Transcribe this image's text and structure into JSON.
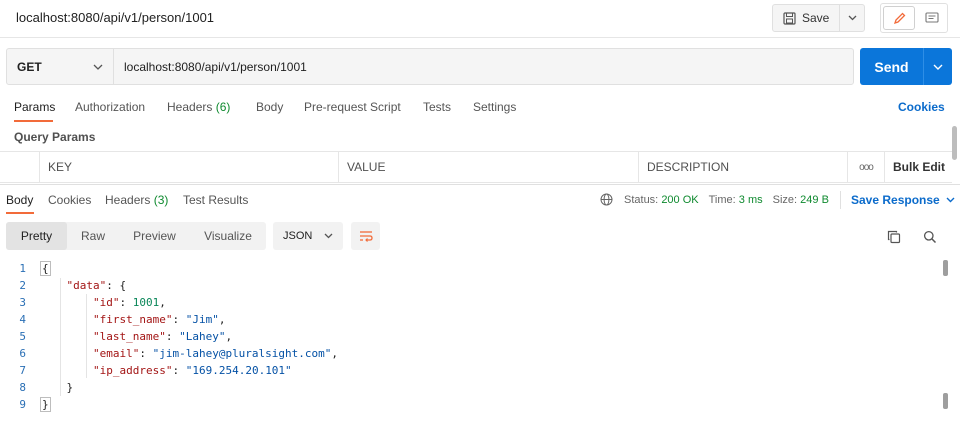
{
  "request": {
    "title": "localhost:8080/api/v1/person/1001",
    "method": "GET",
    "url": "localhost:8080/api/v1/person/1001",
    "save_label": "Save",
    "send_label": "Send"
  },
  "request_tabs": {
    "params": "Params",
    "authorization": "Authorization",
    "headers": "Headers",
    "headers_count": "(6)",
    "body": "Body",
    "prerequest": "Pre-request Script",
    "tests": "Tests",
    "settings": "Settings",
    "cookies": "Cookies"
  },
  "query_params": {
    "label": "Query Params",
    "columns": [
      "KEY",
      "VALUE",
      "DESCRIPTION"
    ],
    "more": "ooo",
    "bulk_edit": "Bulk Edit"
  },
  "response_tabs": {
    "body": "Body",
    "cookies": "Cookies",
    "headers": "Headers",
    "headers_count": "(3)",
    "test_results": "Test Results"
  },
  "response_status": {
    "status_label": "Status:",
    "status_value": "200 OK",
    "time_label": "Time:",
    "time_value": "3 ms",
    "size_label": "Size:",
    "size_value": "249 B",
    "save_response": "Save Response"
  },
  "view_modes": [
    "Pretty",
    "Raw",
    "Preview",
    "Visualize"
  ],
  "format": "JSON",
  "code": {
    "line_numbers": [
      "1",
      "2",
      "3",
      "4",
      "5",
      "6",
      "7",
      "8",
      "9"
    ],
    "data_key": "\"data\"",
    "id_key": "\"id\"",
    "id_value": "1001",
    "first_name_key": "\"first_name\"",
    "first_name_value": "\"Jim\"",
    "last_name_key": "\"last_name\"",
    "last_name_value": "\"Lahey\"",
    "email_key": "\"email\"",
    "email_value": "\"jim-lahey@pluralsight.com\"",
    "ip_key": "\"ip_address\"",
    "ip_value": "\"169.254.20.101\""
  },
  "colors": {
    "accent_tab": "#f26b3a",
    "send_blue": "#0b76da",
    "link_blue": "#0b6bcb",
    "success_green": "#0f8a2f"
  }
}
